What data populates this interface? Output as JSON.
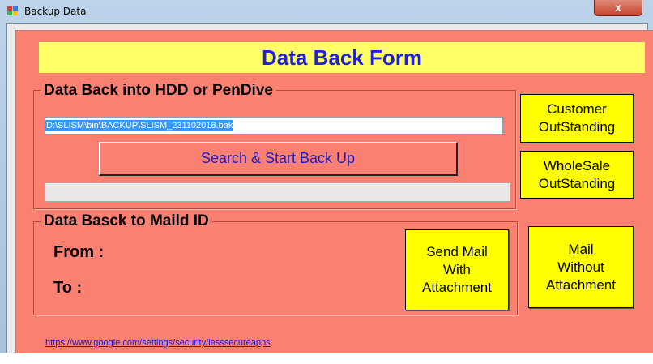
{
  "window": {
    "title": "Backup Data",
    "close_label": "x"
  },
  "form": {
    "header_title": "Data Back Form",
    "hdd_group_label": "Data Back into HDD or PenDive",
    "backup_path_value": "D:\\SLISM\\bin\\BACKUP\\SLISM_231102018.bak",
    "search_button_label": "Search & Start Back Up",
    "progress_fraction": 0,
    "mail_group_label": "Data Basck to Maild ID",
    "from_label": "From :",
    "to_label": "To :",
    "link_text": "https://www.google.com/settings/security/lesssecureapps"
  },
  "buttons": {
    "customer_outstanding": [
      "Customer",
      "OutStanding"
    ],
    "wholesale_outstanding": [
      "WholeSale",
      "OutStanding"
    ],
    "send_mail_with_attachment": [
      "Send Mail",
      "With",
      "Attachment"
    ],
    "mail_without_attachment": [
      "Mail",
      "Without",
      "Attachment"
    ]
  },
  "colors": {
    "form_background": "#fa8072",
    "header_background": "#ffff66",
    "header_text": "#1f1fd9",
    "button_yellow": "#ffff00",
    "link": "#1a1acd"
  }
}
